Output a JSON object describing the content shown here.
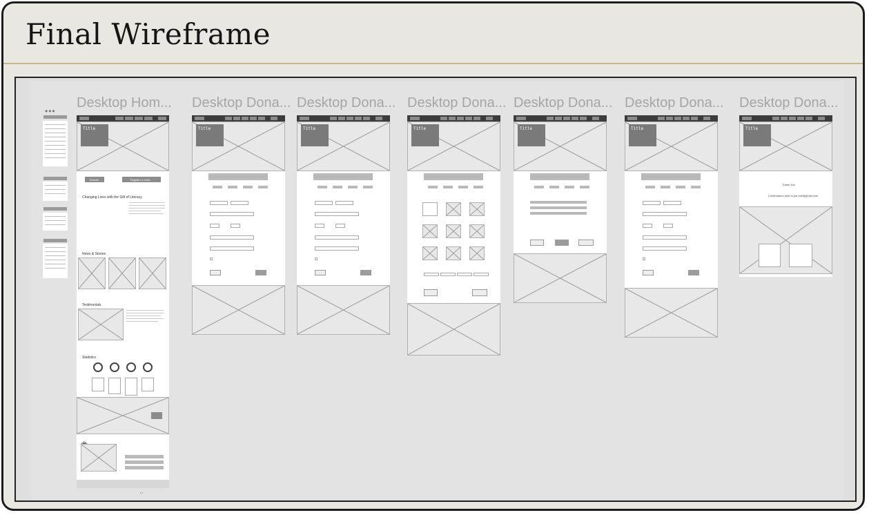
{
  "slide": {
    "title": "Final Wireframe"
  },
  "frames": [
    {
      "label": "Desktop Hom..."
    },
    {
      "label": "Desktop Dona..."
    },
    {
      "label": "Desktop Dona..."
    },
    {
      "label": "Desktop Dona..."
    },
    {
      "label": "Desktop Dona..."
    },
    {
      "label": "Desktop Dona..."
    },
    {
      "label": "Desktop Dona..."
    }
  ],
  "wire": {
    "hero_title": "Title",
    "donate": "Donate",
    "register": "Register a Child",
    "headline": "Changing Lives with the Gift of Literacy",
    "news": "News & Stories",
    "testimonials": "Testimonials",
    "statistics": "Statistics",
    "dollar": "$$",
    "back": "Back",
    "continue": "Continue",
    "confirm": "Confirm",
    "submit": "Submit",
    "next": "Next",
    "thank_you": "Thank You",
    "confirmation": "Confirmation sent to joe.doe@gmail.com"
  },
  "colors": {
    "slide_bg": "#e9e7e2",
    "rule": "#c8b48a",
    "canvas": "#e3e3e3",
    "label": "#a5a5a5"
  }
}
